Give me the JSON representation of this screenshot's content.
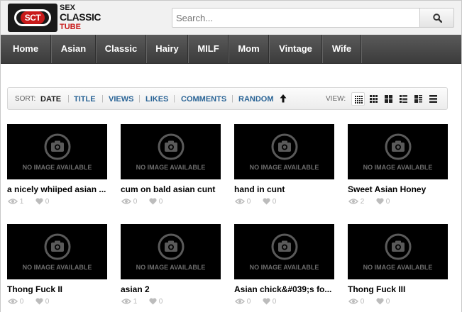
{
  "logo": {
    "badge": "SCT",
    "line1": "SEX",
    "line2": "CLASSIC",
    "line3": "TUBE"
  },
  "search": {
    "placeholder": "Search..."
  },
  "nav": {
    "items": [
      "Home",
      "Asian",
      "Classic",
      "Hairy",
      "MILF",
      "Mom",
      "Vintage",
      "Wife"
    ]
  },
  "sortbar": {
    "sort_label": "SORT:",
    "options": [
      "DATE",
      "TITLE",
      "VIEWS",
      "LIKES",
      "COMMENTS",
      "RANDOM"
    ],
    "active": "DATE",
    "view_label": "VIEW:"
  },
  "no_image_text": "NO IMAGE AVAILABLE",
  "videos": [
    {
      "title": "a nicely whiiped asian ...",
      "views": "1",
      "likes": "0"
    },
    {
      "title": "cum on bald asian cunt",
      "views": "0",
      "likes": "0"
    },
    {
      "title": "hand in cunt",
      "views": "0",
      "likes": "0"
    },
    {
      "title": "Sweet Asian Honey",
      "views": "2",
      "likes": "0"
    },
    {
      "title": "Thong Fuck II",
      "views": "0",
      "likes": "0"
    },
    {
      "title": "asian 2",
      "views": "1",
      "likes": "0"
    },
    {
      "title": "Asian chick&#039;s fo...",
      "views": "0",
      "likes": "0"
    },
    {
      "title": "Thong Fuck III",
      "views": "0",
      "likes": "0"
    }
  ],
  "colors": {
    "accent_link": "#2a6496",
    "logo_red": "#c81a1a",
    "nav_bg": "#474747"
  }
}
